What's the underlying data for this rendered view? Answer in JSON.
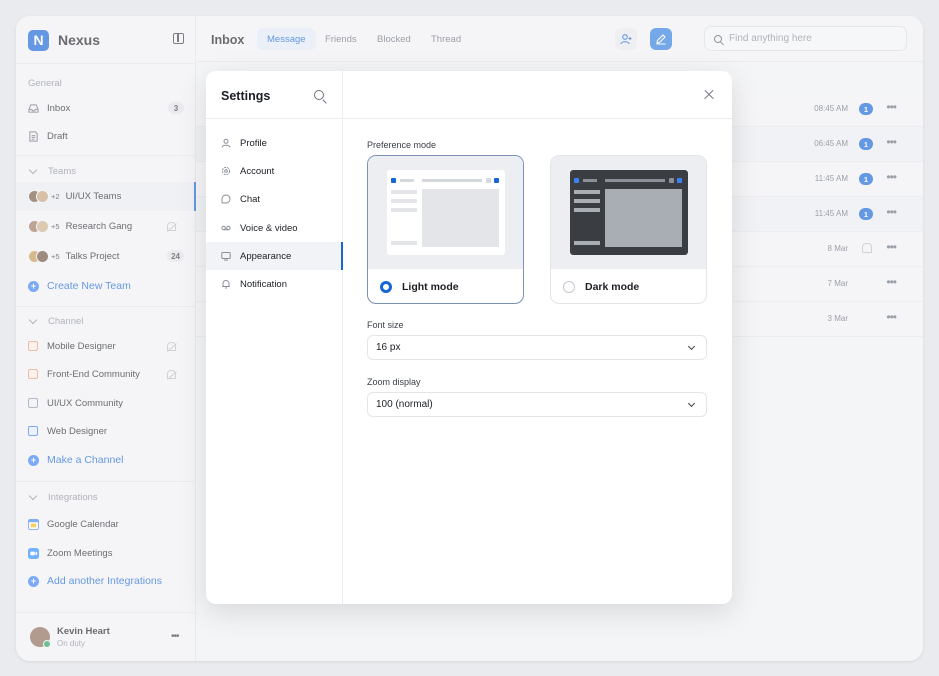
{
  "brand": {
    "name": "Nexus",
    "logo_letter": "N"
  },
  "sidebar": {
    "general_label": "General",
    "items": [
      {
        "label": "Inbox",
        "count": "3"
      },
      {
        "label": "Draft"
      }
    ],
    "teams_label": "Teams",
    "teams": [
      {
        "label": "UI/UX Teams",
        "extra": "+2"
      },
      {
        "label": "Research Gang",
        "extra": "+5"
      },
      {
        "label": "Talks Project",
        "extra": "+5",
        "count": "24"
      }
    ],
    "create_team": "Create New Team",
    "channel_label": "Channel",
    "channels": [
      {
        "label": "Mobile Designer",
        "color": "#e8a07a"
      },
      {
        "label": "Front-End Community",
        "color": "#e8a07a"
      },
      {
        "label": "UI/UX Community",
        "color": "#8a99b0"
      },
      {
        "label": "Web Designer",
        "color": "#3b82f6"
      }
    ],
    "make_channel": "Make a Channel",
    "integrations_label": "Integrations",
    "integrations": [
      {
        "label": "Google Calendar"
      },
      {
        "label": "Zoom Meetings"
      }
    ],
    "add_integration": "Add another Integrations",
    "user": {
      "name": "Kevin Heart",
      "status": "On duty"
    }
  },
  "header": {
    "title": "Inbox",
    "tabs": [
      "Message",
      "Friends",
      "Blocked",
      "Thread"
    ],
    "active_tab": "Message",
    "search_placeholder": "Find anything here"
  },
  "rows": [
    {
      "time": "08:45 AM",
      "badge": "1"
    },
    {
      "time": "06:45 AM",
      "badge": "1"
    },
    {
      "time": "11:45 AM",
      "badge": "1"
    },
    {
      "time": "11:45 AM",
      "badge": "1"
    },
    {
      "time": "8 Mar",
      "muted": true
    },
    {
      "time": "7 Mar"
    },
    {
      "time": "3 Mar"
    }
  ],
  "settings": {
    "title": "Settings",
    "nav": [
      "Profile",
      "Account",
      "Chat",
      "Voice & video",
      "Appearance",
      "Notification"
    ],
    "active": "Appearance",
    "preference_label": "Preference mode",
    "light_mode": "Light mode",
    "dark_mode": "Dark mode",
    "selected_mode": "Light mode",
    "font_size_label": "Font size",
    "font_size_value": "16 px",
    "zoom_label": "Zoom display",
    "zoom_value": "100 (normal)"
  },
  "colors": {
    "accent": "#1766d6",
    "accent_light": "#2f7fe0"
  }
}
